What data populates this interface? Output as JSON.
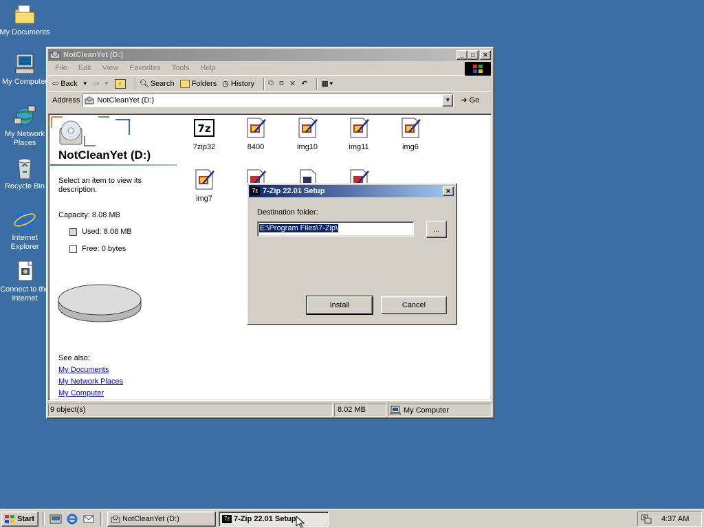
{
  "desktop": {
    "icons": [
      {
        "label": "My Documents",
        "icon": "folder-documents-icon"
      },
      {
        "label": "My Computer",
        "icon": "computer-icon"
      },
      {
        "label": "My Network Places",
        "icon": "network-icon"
      },
      {
        "label": "Recycle Bin",
        "icon": "recycle-bin-icon"
      },
      {
        "label": "Internet Explorer",
        "icon": "internet-explorer-icon"
      },
      {
        "label": "Connect to the Internet",
        "icon": "connect-internet-icon"
      }
    ]
  },
  "explorer": {
    "title": "NotCleanYet (D:)",
    "menu": [
      "File",
      "Edit",
      "View",
      "Favorites",
      "Tools",
      "Help"
    ],
    "toolbar": {
      "back": "Back",
      "search": "Search",
      "folders": "Folders",
      "history": "History"
    },
    "address": {
      "label": "Address",
      "value": "NotCleanYet (D:)",
      "go": "Go"
    },
    "side": {
      "heading": "NotCleanYet (D:)",
      "hint": "Select an item to view its description.",
      "capacity": "Capacity: 8.08 MB",
      "used": "Used: 8.08 MB",
      "free": "Free: 0 bytes",
      "see_also": "See also:",
      "links": [
        "My Documents",
        "My Network Places",
        "My Computer"
      ]
    },
    "files": [
      {
        "name": "7zip32",
        "icon": "7zip-icon"
      },
      {
        "name": "8400",
        "icon": "picture-file-icon"
      },
      {
        "name": "img10",
        "icon": "picture-file-icon"
      },
      {
        "name": "img11",
        "icon": "picture-file-icon"
      },
      {
        "name": "img6",
        "icon": "picture-file-icon"
      },
      {
        "name": "img7",
        "icon": "picture-file-icon"
      }
    ],
    "status": {
      "objects": "9 object(s)",
      "size": "8.02 MB",
      "zone": "My Computer"
    }
  },
  "dialog": {
    "title": "7-Zip 22.01 Setup",
    "dest_label": "Destination folder:",
    "dest_value": "E:\\Program Files\\7-Zip\\",
    "browse": "...",
    "install": "Install",
    "cancel": "Cancel"
  },
  "taskbar": {
    "start": "Start",
    "tasks": [
      "NotCleanYet (D:)",
      "7-Zip 22.01 Setup"
    ],
    "clock": "4:37 AM"
  }
}
